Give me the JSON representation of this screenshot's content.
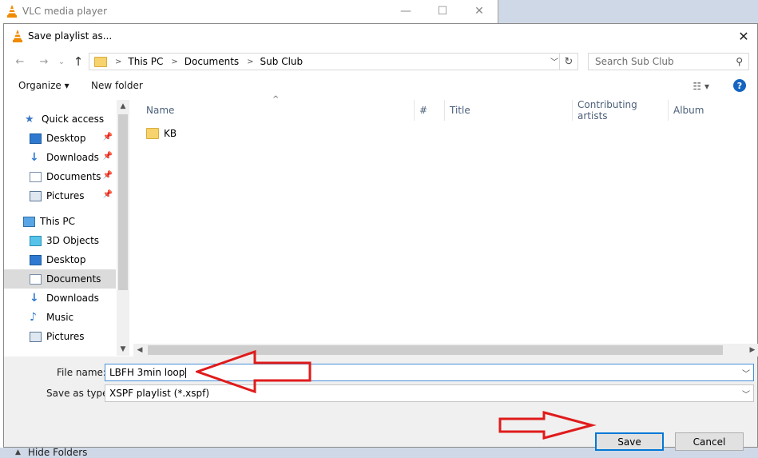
{
  "background_window": {
    "title": "VLC media player",
    "minimize": "—",
    "maximize": "☐",
    "close": "✕"
  },
  "dialog": {
    "title": "Save playlist as...",
    "close": "✕"
  },
  "nav": {
    "back": "←",
    "forward": "→",
    "recent": "⌄",
    "up": "↑",
    "breadcrumb": [
      "This PC",
      "Documents",
      "Sub Club"
    ],
    "search_placeholder": "Search Sub Club"
  },
  "toolbar": {
    "organize": "Organize ▾",
    "new_folder": "New folder",
    "help": "?"
  },
  "sidebar": {
    "items": [
      {
        "label": "Quick access",
        "icon": "star-icon",
        "pinned": false
      },
      {
        "label": "Desktop",
        "icon": "desktop-icon",
        "pinned": true
      },
      {
        "label": "Downloads",
        "icon": "download-icon",
        "pinned": true
      },
      {
        "label": "Documents",
        "icon": "documents-icon",
        "pinned": true
      },
      {
        "label": "Pictures",
        "icon": "pictures-icon",
        "pinned": true
      },
      {
        "label": "This PC",
        "icon": "computer-icon",
        "pinned": false
      },
      {
        "label": "3D Objects",
        "icon": "cube-icon",
        "pinned": false
      },
      {
        "label": "Desktop",
        "icon": "desktop-icon",
        "pinned": false
      },
      {
        "label": "Documents",
        "icon": "documents-icon",
        "pinned": false,
        "selected": true
      },
      {
        "label": "Downloads",
        "icon": "download-icon",
        "pinned": false
      },
      {
        "label": "Music",
        "icon": "music-icon",
        "pinned": false
      },
      {
        "label": "Pictures",
        "icon": "pictures-icon",
        "pinned": false
      }
    ]
  },
  "columns": [
    "Name",
    "#",
    "Title",
    "Contributing artists",
    "Album"
  ],
  "files": [
    {
      "name": "KB",
      "type": "folder"
    }
  ],
  "form": {
    "file_name_label": "File name:",
    "file_name_value": "LBFH 3min loop",
    "save_type_label": "Save as type:",
    "save_type_value": "XSPF playlist (*.xspf)"
  },
  "footer": {
    "hide_folders": "Hide Folders",
    "save": "Save",
    "cancel": "Cancel"
  },
  "colors": {
    "accent": "#0078d7",
    "annotation_red": "#e01b1b",
    "folder_yellow": "#f6d36c"
  }
}
